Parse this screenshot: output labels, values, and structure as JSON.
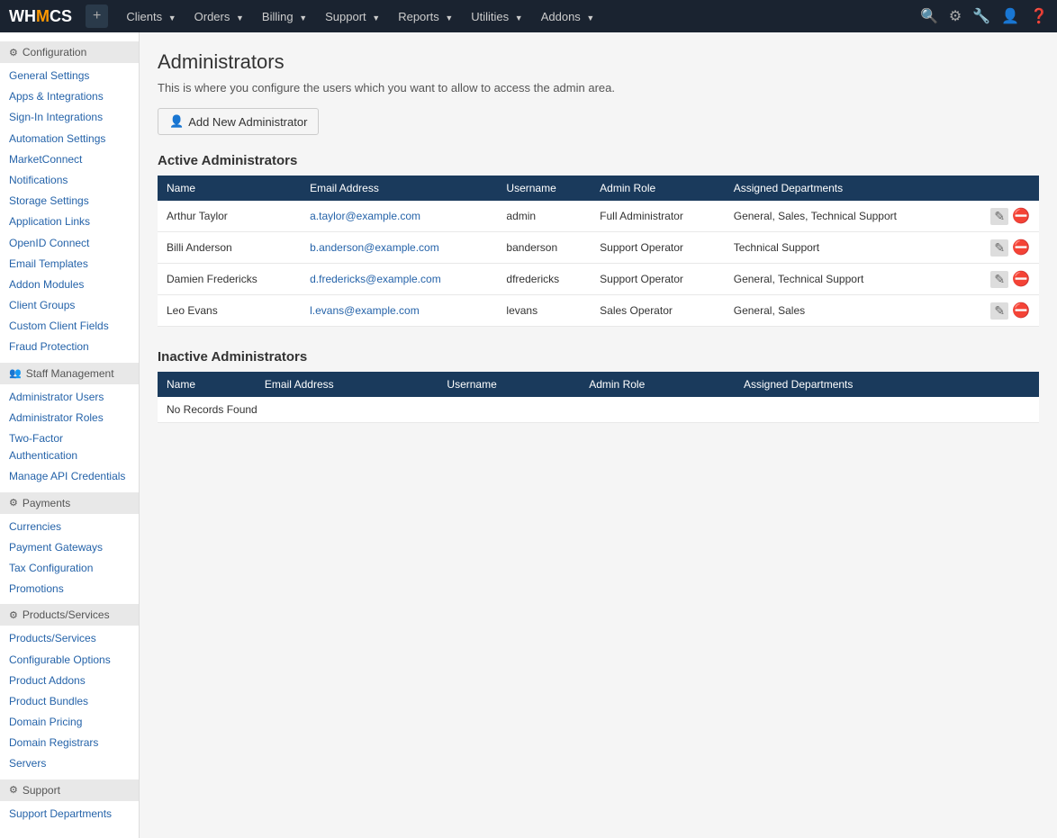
{
  "topnav": {
    "logo": "WHMCS",
    "plus_label": "+",
    "menu_items": [
      {
        "label": "Clients",
        "has_arrow": true
      },
      {
        "label": "Orders",
        "has_arrow": true
      },
      {
        "label": "Billing",
        "has_arrow": true
      },
      {
        "label": "Support",
        "has_arrow": true
      },
      {
        "label": "Reports",
        "has_arrow": true
      },
      {
        "label": "Utilities",
        "has_arrow": true
      },
      {
        "label": "Addons",
        "has_arrow": true
      }
    ]
  },
  "sidebar": {
    "sections": [
      {
        "header": "Configuration",
        "links": [
          "General Settings",
          "Apps & Integrations",
          "Sign-In Integrations",
          "Automation Settings",
          "MarketConnect",
          "Notifications",
          "Storage Settings",
          "Application Links",
          "OpenID Connect",
          "Email Templates",
          "Addon Modules",
          "Client Groups",
          "Custom Client Fields",
          "Fraud Protection"
        ]
      },
      {
        "header": "Staff Management",
        "links": [
          "Administrator Users",
          "Administrator Roles",
          "Two-Factor Authentication",
          "Manage API Credentials"
        ]
      },
      {
        "header": "Payments",
        "links": [
          "Currencies",
          "Payment Gateways",
          "Tax Configuration",
          "Promotions"
        ]
      },
      {
        "header": "Products/Services",
        "links": [
          "Products/Services",
          "Configurable Options",
          "Product Addons",
          "Product Bundles",
          "Domain Pricing",
          "Domain Registrars",
          "Servers"
        ]
      },
      {
        "header": "Support",
        "links": [
          "Support Departments"
        ]
      }
    ]
  },
  "main": {
    "page_title": "Administrators",
    "page_desc": "This is where you configure the users which you want to allow to access the admin area.",
    "add_button_label": "Add New Administrator",
    "active_section_title": "Active Administrators",
    "inactive_section_title": "Inactive Administrators",
    "table_headers": [
      "Name",
      "Email Address",
      "Username",
      "Admin Role",
      "Assigned Departments"
    ],
    "active_admins": [
      {
        "name": "Arthur Taylor",
        "email": "a.taylor@example.com",
        "username": "admin",
        "role": "Full Administrator",
        "departments": "General, Sales, Technical Support"
      },
      {
        "name": "Billi Anderson",
        "email": "b.anderson@example.com",
        "username": "banderson",
        "role": "Support Operator",
        "departments": "Technical Support"
      },
      {
        "name": "Damien Fredericks",
        "email": "d.fredericks@example.com",
        "username": "dfredericks",
        "role": "Support Operator",
        "departments": "General, Technical Support"
      },
      {
        "name": "Leo Evans",
        "email": "l.evans@example.com",
        "username": "levans",
        "role": "Sales Operator",
        "departments": "General, Sales"
      }
    ],
    "inactive_table_headers": [
      "Name",
      "Email Address",
      "Username",
      "Admin Role",
      "Assigned Departments"
    ],
    "no_records_text": "No Records Found"
  }
}
